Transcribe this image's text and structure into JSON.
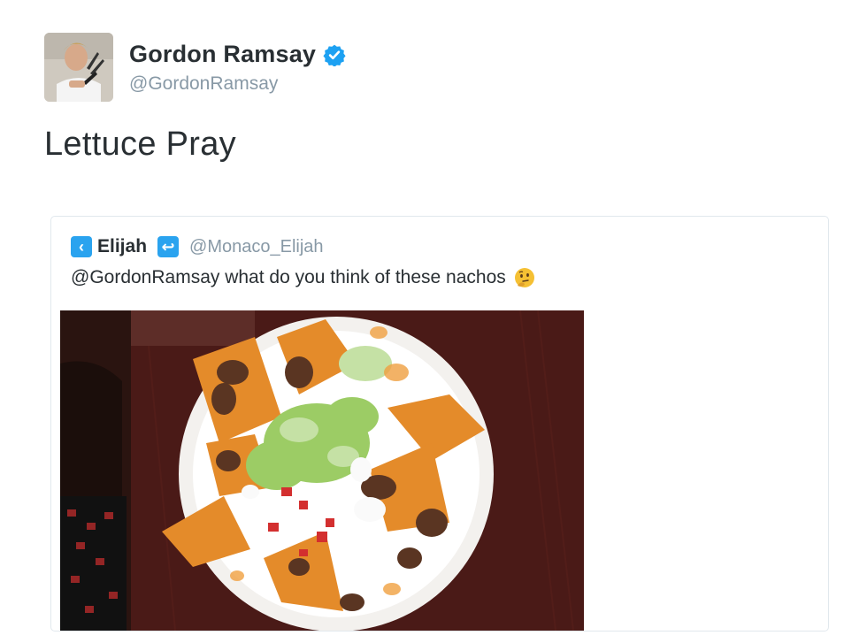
{
  "tweet": {
    "author_name": "Gordon Ramsay",
    "author_handle": "@GordonRamsay",
    "text": "Lettuce Pray",
    "verified_icon": "verified-badge-icon",
    "accent_color": "#1da1f2"
  },
  "quoted_tweet": {
    "author_name": "Elijah",
    "author_handle": "@Monaco_Elijah",
    "text": "@GordonRamsay what do you think of these nachos",
    "emoji": "thinking-face-emoji",
    "image_alt": "plate of nachos",
    "left_icon": "arrow-left-icon",
    "right_icon": "arrow-return-icon"
  }
}
